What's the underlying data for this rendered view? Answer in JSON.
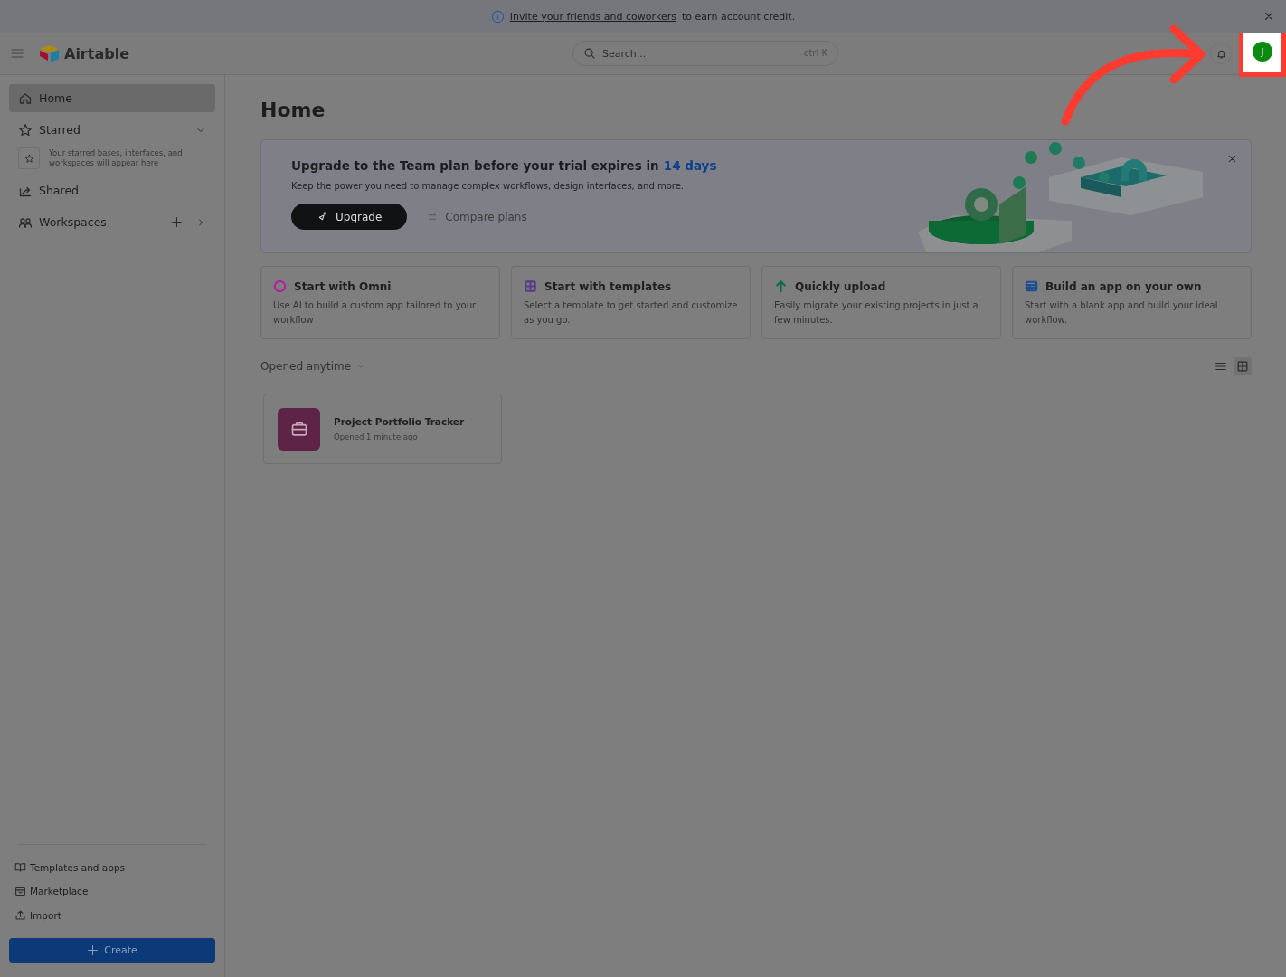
{
  "banner": {
    "link": "Invite your friends and coworkers",
    "text": "to earn account credit."
  },
  "header": {
    "logo": "Airtable",
    "search": {
      "placeholder": "Search...",
      "shortcut": "ctrl K"
    },
    "avatar": "J",
    "highlighted": true
  },
  "sidebar": {
    "items": [
      {
        "kind": "link",
        "label": "Home",
        "selected": true
      },
      {
        "kind": "section",
        "label": "Starred",
        "selected": false,
        "expanded": true,
        "hint": "Your starred bases, interfaces, and workspaces will appear here"
      },
      {
        "kind": "link",
        "label": "Shared",
        "selected": false
      },
      {
        "kind": "workspaces",
        "label": "Workspaces",
        "selected": false,
        "expanded": false
      }
    ],
    "footer": [
      "Templates and apps",
      "Marketplace",
      "Import"
    ],
    "create": "Create"
  },
  "page": {
    "title": "Home",
    "promo": {
      "title": "Upgrade to the Team plan before your trial expires in",
      "days": "14 days",
      "subtitle": "Keep the power you need to manage complex workflows, design interfaces, and more.",
      "primary": "Upgrade",
      "secondary": "Compare plans"
    },
    "start_cards": [
      {
        "title": "Start with Omni",
        "text": "Use AI to build a custom app tailored to your workflow",
        "color": "#b0209a"
      },
      {
        "title": "Start with templates",
        "text": "Select a template to get started and customize as you go.",
        "color": "#5a3c86"
      },
      {
        "title": "Quickly upload",
        "text": "Easily migrate your existing projects in just a few minutes.",
        "color": "#0b6a4c"
      },
      {
        "title": "Build an app on your own",
        "text": "Start with a blank app and build your ideal workflow.",
        "color": "#1c4f8f"
      }
    ],
    "filter": "Opened anytime",
    "views": [
      {
        "selected": false
      },
      {
        "selected": true
      }
    ],
    "bases": [
      {
        "name": "Project Portfolio Tracker",
        "opened": "Opened 1 minute ago",
        "color": "#5e2447"
      }
    ]
  }
}
